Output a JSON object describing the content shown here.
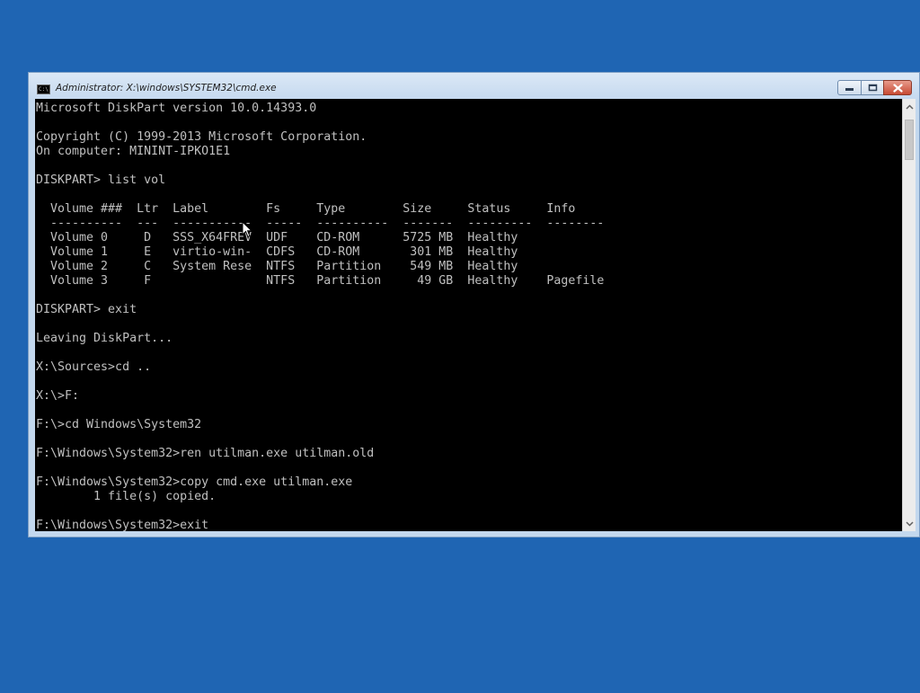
{
  "window": {
    "title": "Administrator: X:\\windows\\SYSTEM32\\cmd.exe",
    "icon_text": "C:\\"
  },
  "console": {
    "lines": [
      "Microsoft DiskPart version 10.0.14393.0",
      "",
      "Copyright (C) 1999-2013 Microsoft Corporation.",
      "On computer: MININT-IPKO1E1",
      "",
      "DISKPART> list vol",
      "",
      "  Volume ###  Ltr  Label        Fs     Type        Size     Status     Info",
      "  ----------  ---  -----------  -----  ----------  -------  ---------  --------",
      "  Volume 0     D   SSS_X64FREV  UDF    CD-ROM      5725 MB  Healthy",
      "  Volume 1     E   virtio-win-  CDFS   CD-ROM       301 MB  Healthy",
      "  Volume 2     C   System Rese  NTFS   Partition    549 MB  Healthy",
      "  Volume 3     F                NTFS   Partition     49 GB  Healthy    Pagefile",
      "",
      "DISKPART> exit",
      "",
      "Leaving DiskPart...",
      "",
      "X:\\Sources>cd ..",
      "",
      "X:\\>F:",
      "",
      "F:\\>cd Windows\\System32",
      "",
      "F:\\Windows\\System32>ren utilman.exe utilman.old",
      "",
      "F:\\Windows\\System32>copy cmd.exe utilman.exe",
      "        1 file(s) copied.",
      "",
      "F:\\Windows\\System32>exit"
    ]
  },
  "colors": {
    "desktop": "#1f65b3",
    "console_bg": "#000000",
    "console_text": "#c0c0c0",
    "close_button": "#c74a33"
  },
  "icons": {
    "minimize": "minimize-icon",
    "maximize": "maximize-icon",
    "close": "close-icon",
    "scroll_up": "chevron-up-icon",
    "scroll_down": "chevron-down-icon"
  }
}
